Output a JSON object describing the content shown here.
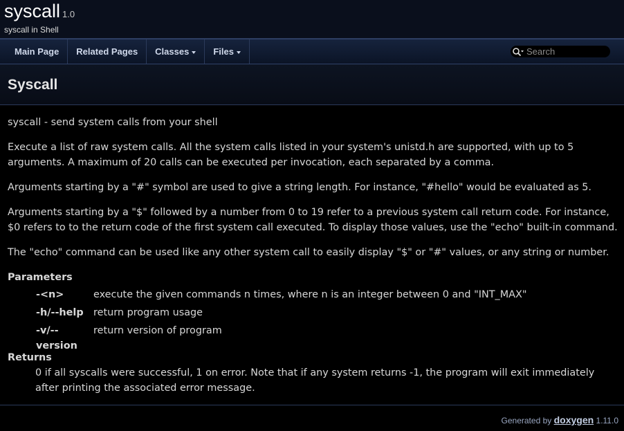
{
  "project": {
    "name": "syscall",
    "number": "1.0",
    "brief": "syscall in Shell"
  },
  "nav": {
    "items": [
      {
        "label": "Main Page",
        "dropdown": false
      },
      {
        "label": "Related Pages",
        "dropdown": false
      },
      {
        "label": "Classes",
        "dropdown": true
      },
      {
        "label": "Files",
        "dropdown": true
      }
    ],
    "search_placeholder": "Search"
  },
  "page": {
    "title": "Syscall",
    "brief": "syscall - send system calls from your shell",
    "paragraphs": [
      "Execute a list of raw system calls. All the system calls listed in your system's unistd.h are supported, with up to 5 arguments. A maximum of 20 calls can be executed per invocation, each separated by a comma.",
      "Arguments starting by a \"#\" symbol are used to give a string length. For instance, \"#hello\" would be evaluated as 5.",
      "Arguments starting by a \"$\" followed by a number from 0 to 19 refer to a previous system call return code. For instance, $0 refers to to the return code of the first system call executed. To display those values, use the \"echo\" built-in command.",
      "The \"echo\" command can be used like any other system call to easily display \"$\" or \"#\" values, or any string or number."
    ],
    "parameters_title": "Parameters",
    "parameters": [
      {
        "name": "-<n>",
        "desc": "execute the given commands n times, where n is an integer between 0 and \"INT_MAX\""
      },
      {
        "name": "-h/--help",
        "desc": "return program usage"
      },
      {
        "name": "-v/--version",
        "desc": "return version of program"
      }
    ],
    "returns_title": "Returns",
    "returns": "0 if all syscalls were successful, 1 on error. Note that if any system returns -1, the program will exit immediately after printing the associated error message."
  },
  "footer": {
    "generated_by": "Generated by",
    "logo": "doxygen",
    "version": "1.11.0"
  }
}
